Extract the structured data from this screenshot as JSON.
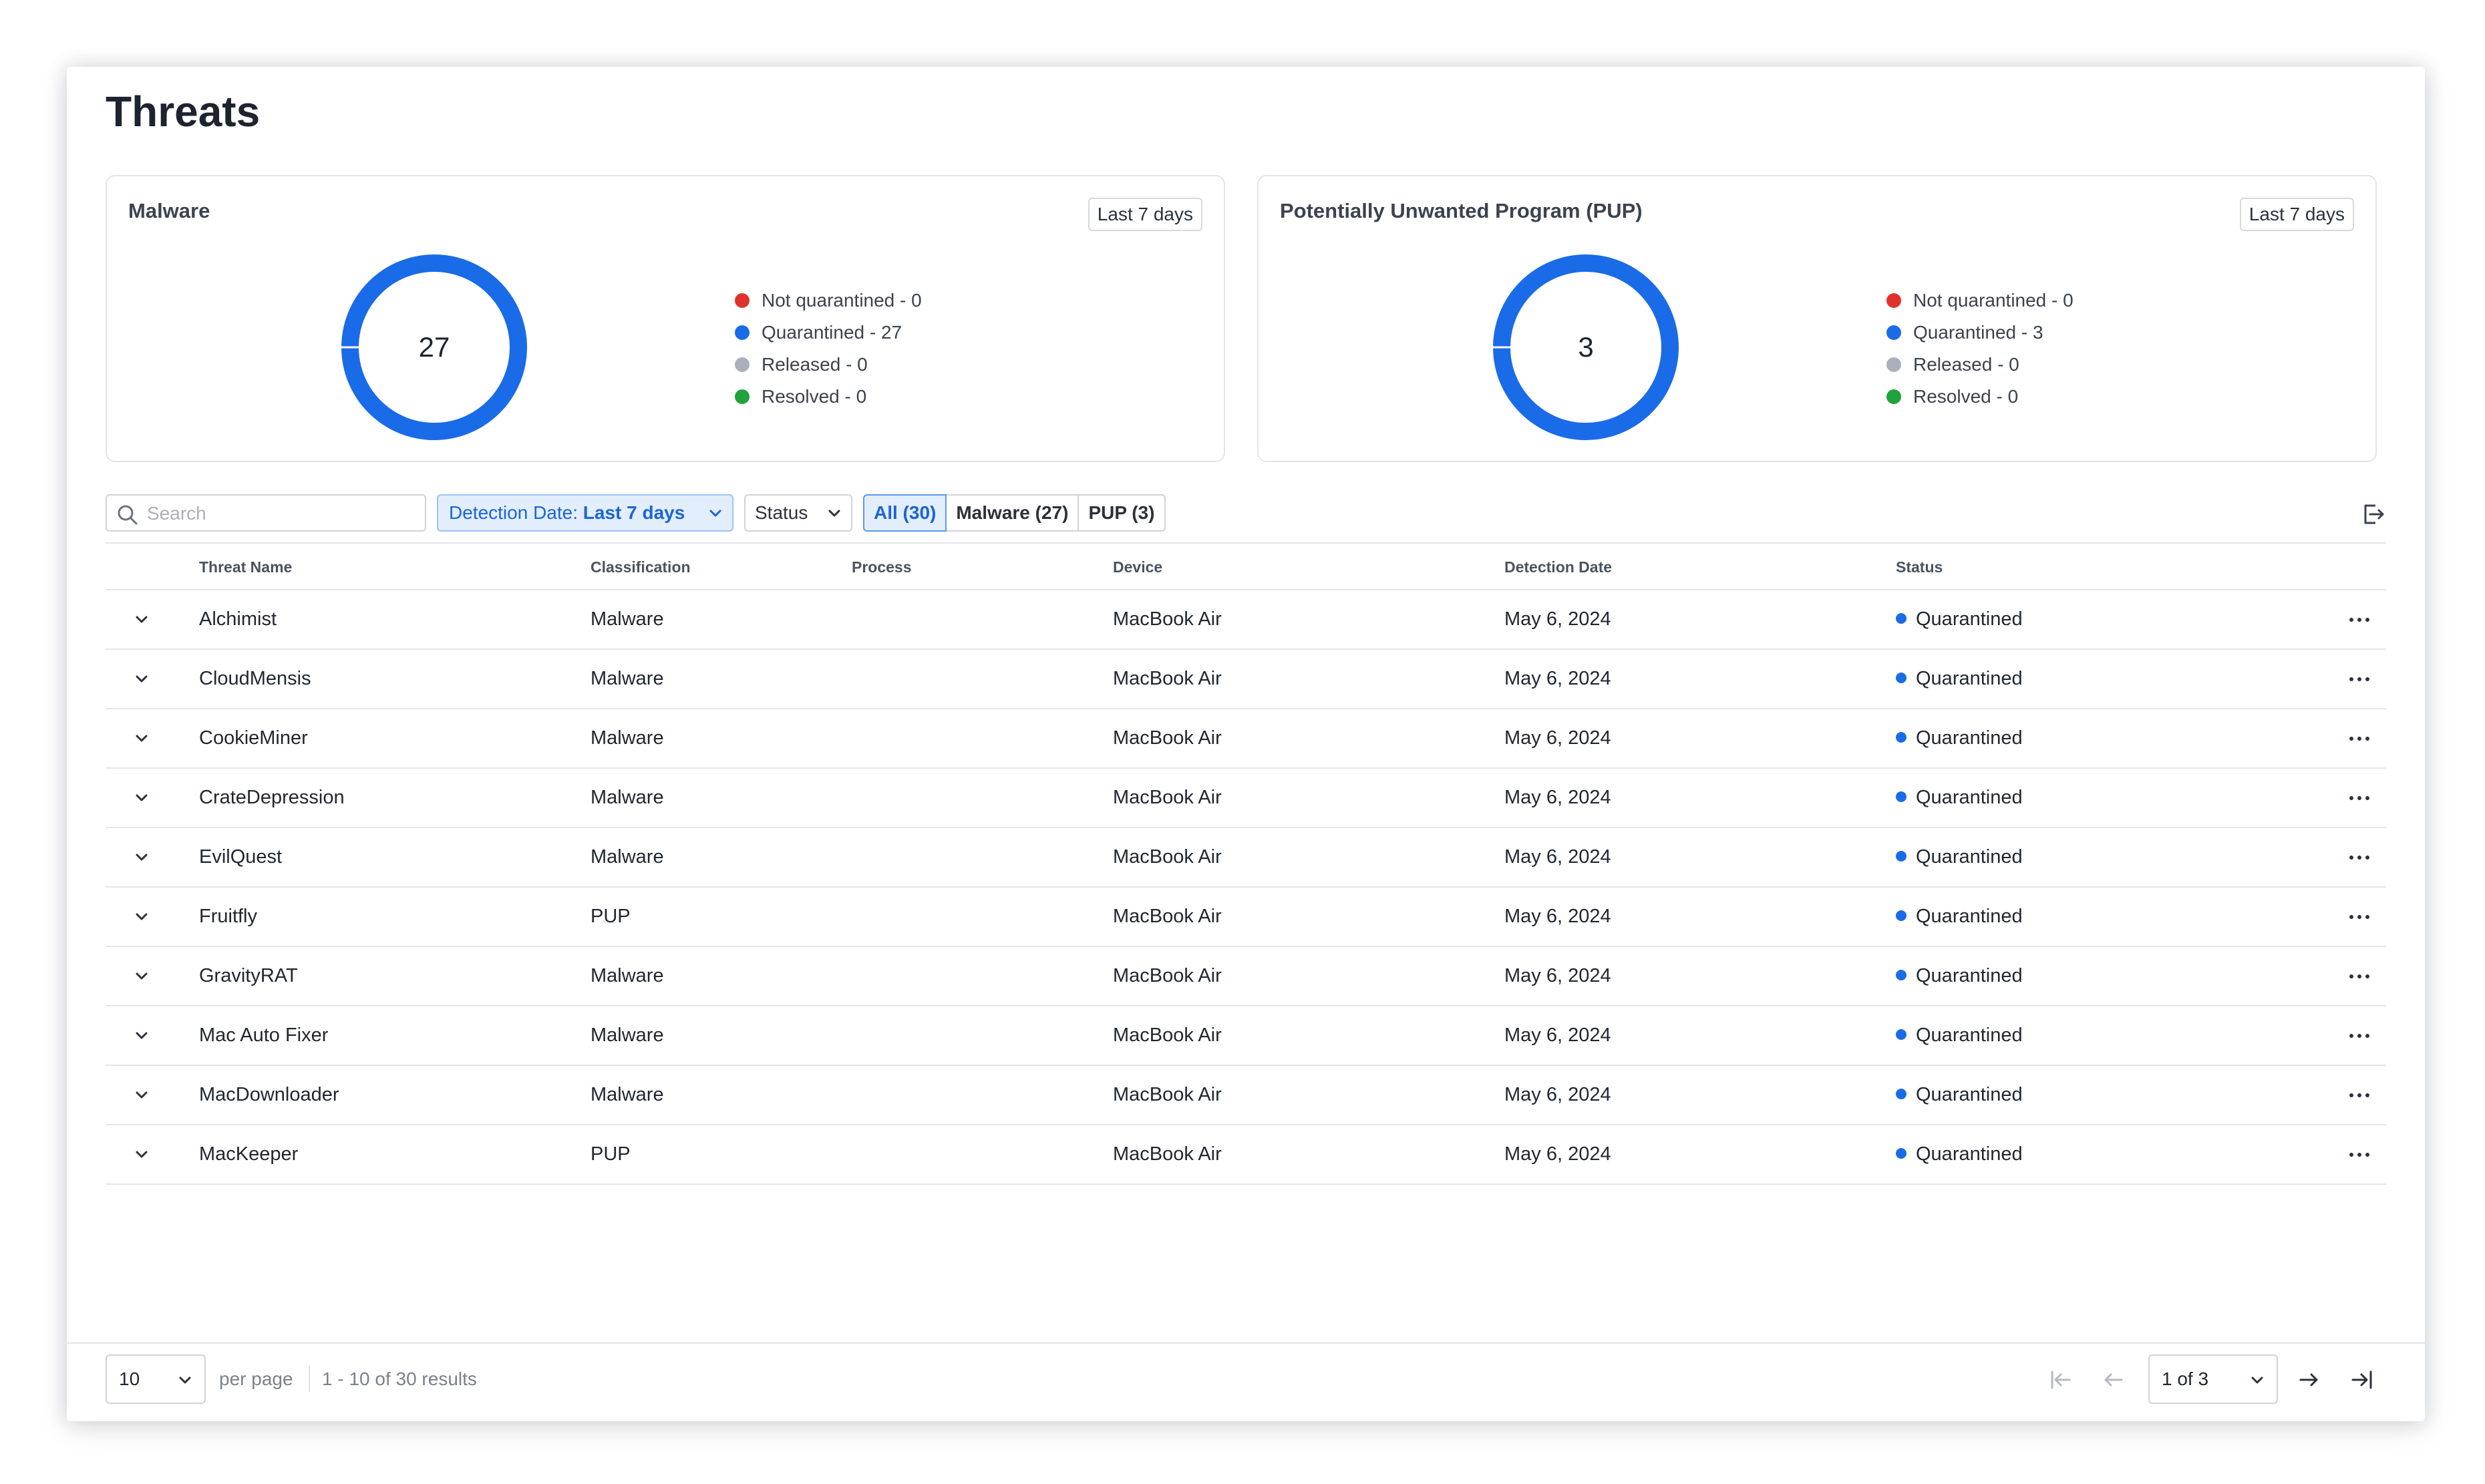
{
  "page": {
    "title": "Threats"
  },
  "cards": [
    {
      "title": "Malware",
      "range": "Last 7 days",
      "total": "27",
      "legend": [
        {
          "label": "Not quarantined - 0",
          "color": "#e0322c",
          "value": 0
        },
        {
          "label": "Quarantined - 27",
          "color": "#1a6be8",
          "value": 27
        },
        {
          "label": "Released - 0",
          "color": "#a9b0bb",
          "value": 0
        },
        {
          "label": "Resolved - 0",
          "color": "#1fa33c",
          "value": 0
        }
      ]
    },
    {
      "title": "Potentially Unwanted Program (PUP)",
      "range": "Last 7 days",
      "total": "3",
      "legend": [
        {
          "label": "Not quarantined - 0",
          "color": "#e0322c",
          "value": 0
        },
        {
          "label": "Quarantined - 3",
          "color": "#1a6be8",
          "value": 3
        },
        {
          "label": "Released - 0",
          "color": "#a9b0bb",
          "value": 0
        },
        {
          "label": "Resolved - 0",
          "color": "#1fa33c",
          "value": 0
        }
      ]
    }
  ],
  "toolbar": {
    "search_placeholder": "Search",
    "date_filter_prefix": "Detection Date: ",
    "date_filter_value": "Last 7 days",
    "status_filter": "Status",
    "segments": [
      {
        "label": "All (30)",
        "active": true
      },
      {
        "label": "Malware (27)",
        "active": false
      },
      {
        "label": "PUP (3)",
        "active": false
      }
    ]
  },
  "table": {
    "columns": [
      "Threat Name",
      "Classification",
      "Process",
      "Device",
      "Detection Date",
      "Status"
    ],
    "rows": [
      {
        "name": "Alchimist",
        "classification": "Malware",
        "process": "",
        "device": "MacBook Air",
        "date": "May 6, 2024",
        "status": "Quarantined"
      },
      {
        "name": "CloudMensis",
        "classification": "Malware",
        "process": "",
        "device": "MacBook Air",
        "date": "May 6, 2024",
        "status": "Quarantined"
      },
      {
        "name": "CookieMiner",
        "classification": "Malware",
        "process": "",
        "device": "MacBook Air",
        "date": "May 6, 2024",
        "status": "Quarantined"
      },
      {
        "name": "CrateDepression",
        "classification": "Malware",
        "process": "",
        "device": "MacBook Air",
        "date": "May 6, 2024",
        "status": "Quarantined"
      },
      {
        "name": "EvilQuest",
        "classification": "Malware",
        "process": "",
        "device": "MacBook Air",
        "date": "May 6, 2024",
        "status": "Quarantined"
      },
      {
        "name": "Fruitfly",
        "classification": "PUP",
        "process": "",
        "device": "MacBook Air",
        "date": "May 6, 2024",
        "status": "Quarantined"
      },
      {
        "name": "GravityRAT",
        "classification": "Malware",
        "process": "",
        "device": "MacBook Air",
        "date": "May 6, 2024",
        "status": "Quarantined"
      },
      {
        "name": "Mac Auto Fixer",
        "classification": "Malware",
        "process": "",
        "device": "MacBook Air",
        "date": "May 6, 2024",
        "status": "Quarantined"
      },
      {
        "name": "MacDownloader",
        "classification": "Malware",
        "process": "",
        "device": "MacBook Air",
        "date": "May 6, 2024",
        "status": "Quarantined"
      },
      {
        "name": "MacKeeper",
        "classification": "PUP",
        "process": "",
        "device": "MacBook Air",
        "date": "May 6, 2024",
        "status": "Quarantined"
      }
    ]
  },
  "footer": {
    "per_page_value": "10",
    "per_page_label": "per page",
    "results": "1 - 10 of 30 results",
    "page_select": "1 of 3"
  },
  "colors": {
    "accent": "#1a6be8",
    "active_bg": "#e3eefc",
    "border": "#e3e6ea"
  }
}
